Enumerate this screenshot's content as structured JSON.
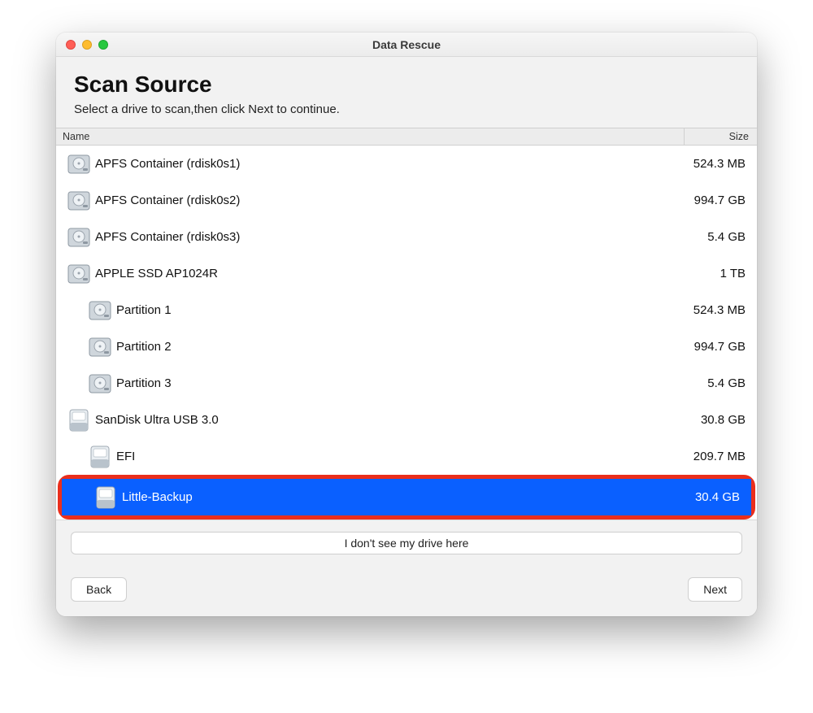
{
  "window": {
    "title": "Data Rescue"
  },
  "header": {
    "title": "Scan Source",
    "subtitle": "Select a drive to scan,then click Next to continue."
  },
  "columns": {
    "name": "Name",
    "size": "Size"
  },
  "drives": [
    {
      "label": "APFS Container (rdisk0s1)",
      "size": "524.3 MB",
      "indent": 0,
      "icon": "hdd",
      "selected": false
    },
    {
      "label": "APFS Container (rdisk0s2)",
      "size": "994.7 GB",
      "indent": 0,
      "icon": "hdd",
      "selected": false
    },
    {
      "label": "APFS Container (rdisk0s3)",
      "size": "5.4 GB",
      "indent": 0,
      "icon": "hdd",
      "selected": false
    },
    {
      "label": "APPLE SSD AP1024R",
      "size": "1 TB",
      "indent": 0,
      "icon": "hdd",
      "selected": false
    },
    {
      "label": "Partition 1",
      "size": "524.3 MB",
      "indent": 1,
      "icon": "hdd",
      "selected": false
    },
    {
      "label": "Partition 2",
      "size": "994.7 GB",
      "indent": 1,
      "icon": "hdd",
      "selected": false
    },
    {
      "label": "Partition 3",
      "size": "5.4 GB",
      "indent": 1,
      "icon": "hdd",
      "selected": false
    },
    {
      "label": "SanDisk Ultra USB 3.0",
      "size": "30.8 GB",
      "indent": 0,
      "icon": "ext",
      "selected": false
    },
    {
      "label": "EFI",
      "size": "209.7 MB",
      "indent": 1,
      "icon": "ext",
      "selected": false
    },
    {
      "label": "Little-Backup",
      "size": "30.4 GB",
      "indent": 1,
      "icon": "ext",
      "selected": true,
      "highlight": true
    }
  ],
  "footer": {
    "not_found_label": "I don't see my drive here",
    "back_label": "Back",
    "next_label": "Next"
  }
}
